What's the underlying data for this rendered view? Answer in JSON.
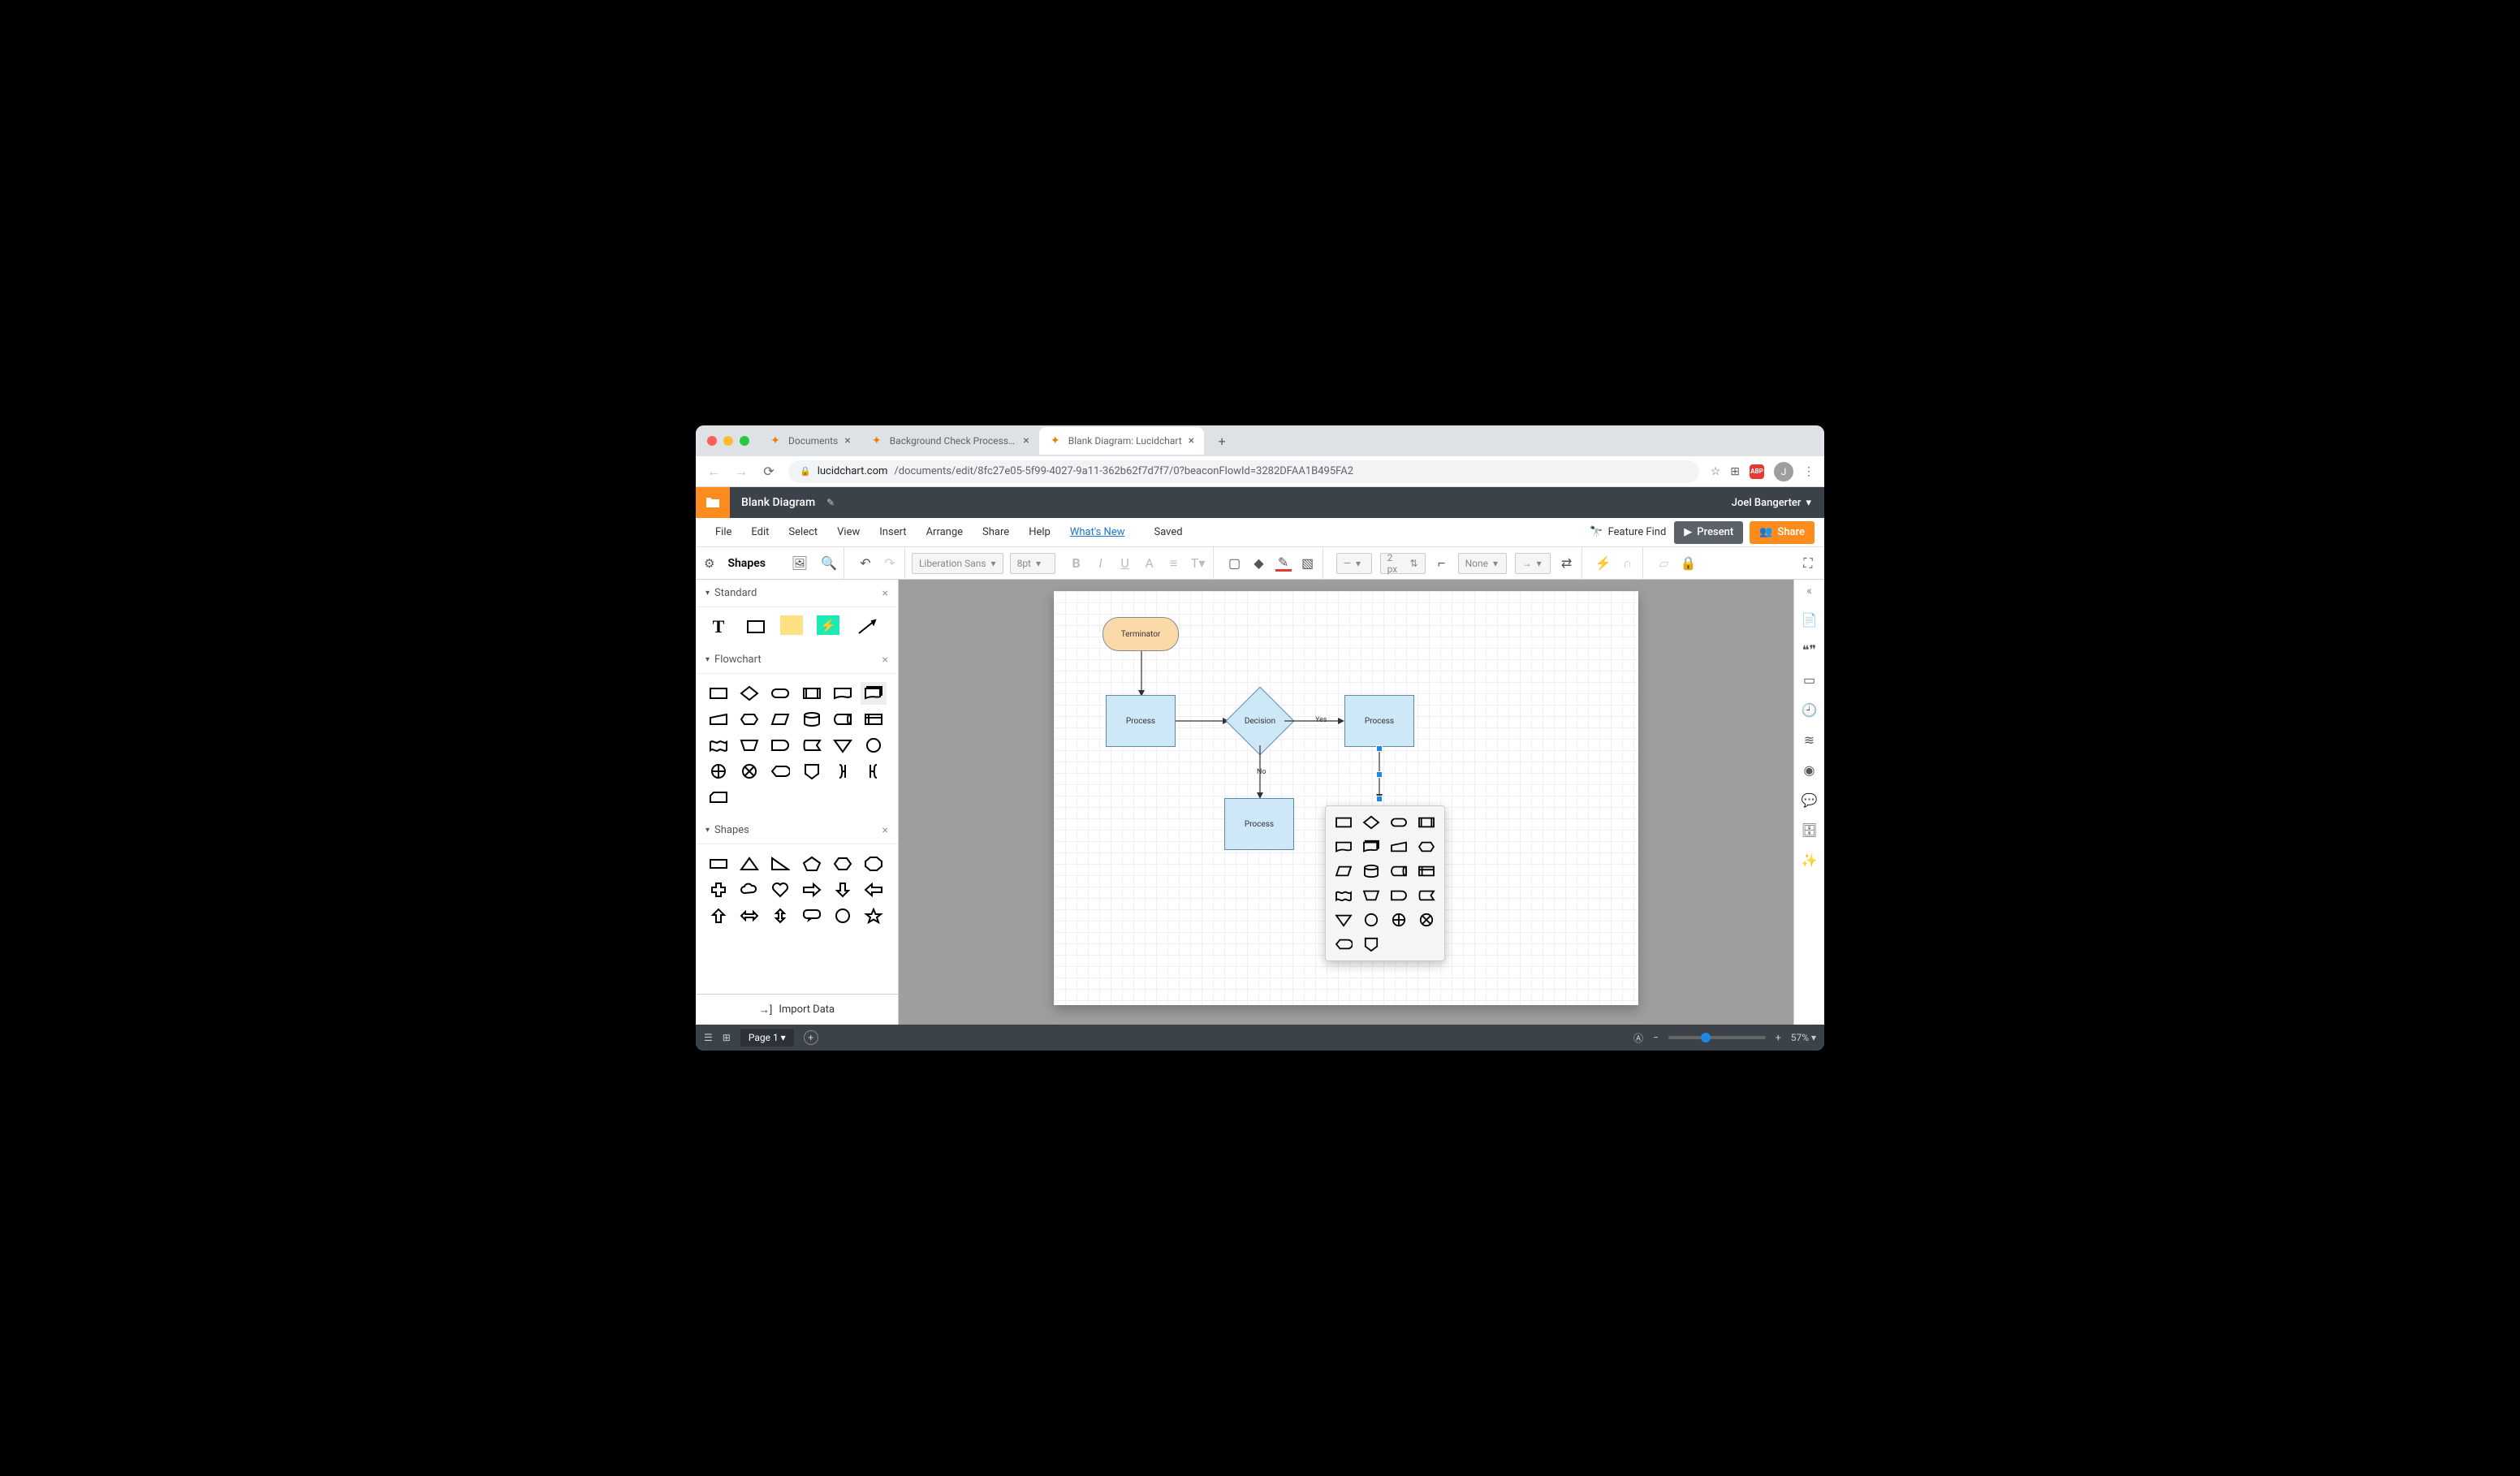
{
  "browser": {
    "tabs": [
      {
        "label": "Documents",
        "active": false
      },
      {
        "label": "Background Check Process Fl…",
        "active": false
      },
      {
        "label": "Blank Diagram: Lucidchart",
        "active": true
      }
    ],
    "url_host": "lucidchart.com",
    "url_path": "/documents/edit/8fc27e05-5f99-4027-9a11-362b62f7d7f7/0?beaconFlowId=3282DFAA1B495FA2",
    "avatar_initial": "J"
  },
  "app": {
    "doc_title": "Blank Diagram",
    "user_name": "Joel Bangerter",
    "menu": [
      "File",
      "Edit",
      "Select",
      "View",
      "Insert",
      "Arrange",
      "Share",
      "Help"
    ],
    "whats_new": "What's New",
    "saved": "Saved",
    "feature_find": "Feature Find",
    "present": "Present",
    "share": "Share"
  },
  "toolbar": {
    "shapes_label": "Shapes",
    "font": "Liberation Sans",
    "size": "8pt",
    "line_width": "2 px",
    "fill": "None"
  },
  "panels": {
    "standard": "Standard",
    "flowchart": "Flowchart",
    "shapes": "Shapes",
    "import": "Import Data"
  },
  "canvas": {
    "nodes": {
      "terminator": "Terminator",
      "process1": "Process",
      "decision": "Decision",
      "process2": "Process",
      "process3": "Process"
    },
    "edge_yes": "Yes",
    "edge_no": "No"
  },
  "status": {
    "page": "Page 1",
    "zoom": "57%"
  }
}
